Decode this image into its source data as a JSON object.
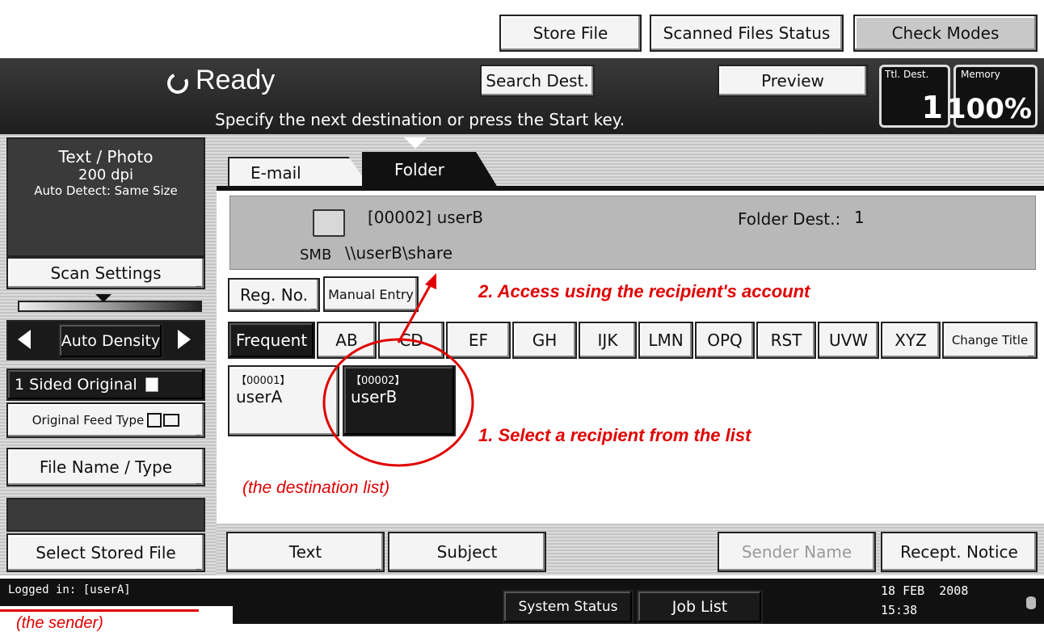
{
  "top_buttons": {
    "store_file": "Store File",
    "scanned_files_status": "Scanned Files Status",
    "check_modes": "Check Modes"
  },
  "status": {
    "ready": "Ready",
    "message": "Specify the next destination or press the Start key.",
    "search_dest": "Search Dest.",
    "preview": "Preview",
    "ttl_dest_label": "Ttl. Dest.",
    "ttl_dest_value": "1",
    "memory_label": "Memory",
    "memory_value": "100%"
  },
  "sidebar": {
    "scan_info": [
      "Text / Photo",
      "200 dpi",
      "Auto Detect: Same Size"
    ],
    "scan_settings": "Scan Settings",
    "auto_density": "Auto Density",
    "sided_original": "1 Sided Original",
    "original_feed_type": "Original Feed Type",
    "file_name_type": "File Name / Type",
    "select_stored_file": "Select Stored File"
  },
  "tabs": {
    "email": "E-mail",
    "folder": "Folder"
  },
  "destination": {
    "name": "[00002] userB",
    "protocol": "SMB",
    "path": "\\\\userB\\share",
    "folder_dest_label": "Folder Dest.:",
    "folder_dest_value": "1"
  },
  "buttons": {
    "reg_no": "Reg. No.",
    "manual_entry": "Manual Entry",
    "change_title": "Change Title"
  },
  "index_tabs": [
    "Frequent",
    "AB",
    "CD",
    "EF",
    "GH",
    "IJK",
    "LMN",
    "OPQ",
    "RST",
    "UVW",
    "XYZ"
  ],
  "entries": [
    {
      "number": "【00001】",
      "name": "userA",
      "selected": false
    },
    {
      "number": "【00002】",
      "name": "userB",
      "selected": true
    }
  ],
  "bottom_buttons": {
    "text": "Text",
    "subject": "Subject",
    "sender_name": "Sender Name",
    "recept_notice": "Recept. Notice"
  },
  "footer": {
    "logged_in": "Logged in: [userA]",
    "system_status": "System Status",
    "job_list": "Job List",
    "date": "18 FEB  2008",
    "time": "15:38"
  },
  "annotations": {
    "step1": "1. Select a recipient from the list",
    "step2": "2. Access using the recipient's account",
    "destination_list": "(the destination list)",
    "sender": "(the sender)"
  },
  "colors": {
    "annotation_red": "#e00000",
    "dark_bar": "#1a1a1a",
    "panel_gray": "#b8b8b8"
  }
}
